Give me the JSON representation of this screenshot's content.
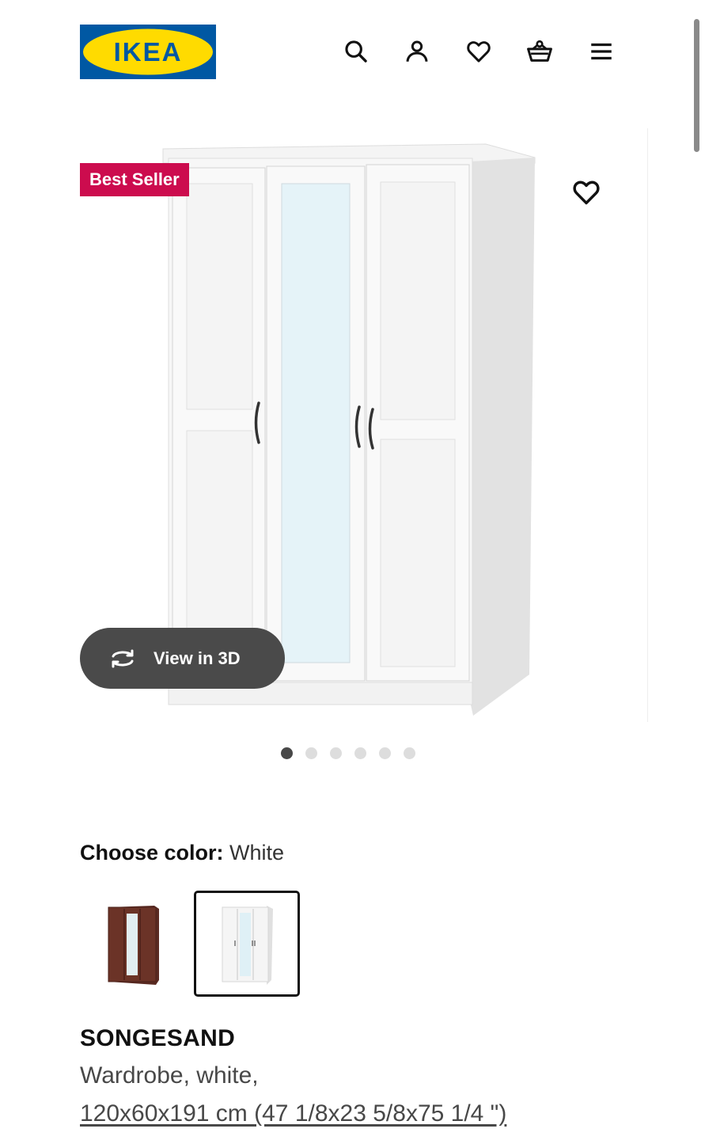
{
  "header": {
    "logo_text": "IKEA",
    "brand_colors": {
      "blue": "#0058a3",
      "yellow": "#ffdb00"
    },
    "icons": [
      "search-icon",
      "account-icon",
      "heart-icon",
      "basket-icon",
      "menu-icon"
    ]
  },
  "gallery": {
    "badge": "Best Seller",
    "badge_color": "#cc0c4e",
    "view_3d_label": "View in 3D",
    "image_count": 6,
    "active_index": 0
  },
  "color_chooser": {
    "label": "Choose color:",
    "selected": "White",
    "options": [
      {
        "name": "brown",
        "selected": false
      },
      {
        "name": "white",
        "selected": true
      }
    ]
  },
  "product": {
    "name": "SONGESAND",
    "description": "Wardrobe, white,",
    "size": "120x60x191 cm (47 1/8x23 5/8x75 1/4 \")"
  }
}
